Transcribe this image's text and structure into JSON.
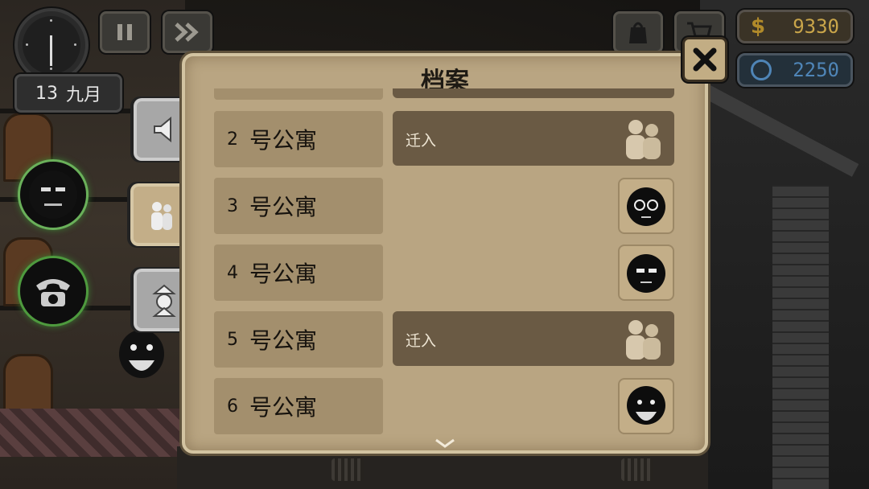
{
  "hud": {
    "date_day": "13",
    "date_month": "九月",
    "money": "9330",
    "money_symbol": "$",
    "gems": "2250"
  },
  "panel": {
    "title": "档案",
    "rows": [
      {
        "number": "2",
        "label": "号公寓",
        "status": "迁入"
      },
      {
        "number": "3",
        "label": "号公寓",
        "status": ""
      },
      {
        "number": "4",
        "label": "号公寓",
        "status": ""
      },
      {
        "number": "5",
        "label": "号公寓",
        "status": "迁入"
      },
      {
        "number": "6",
        "label": "号公寓",
        "status": ""
      }
    ]
  },
  "tabs": [
    "speaker-icon",
    "people-icon",
    "spy-icon"
  ],
  "colors": {
    "panel_bg": "#b9a582",
    "row_bg": "#a38f6d",
    "move_bg": "#6a5a44",
    "money": "#c9a54a",
    "gems": "#4f85b7"
  }
}
